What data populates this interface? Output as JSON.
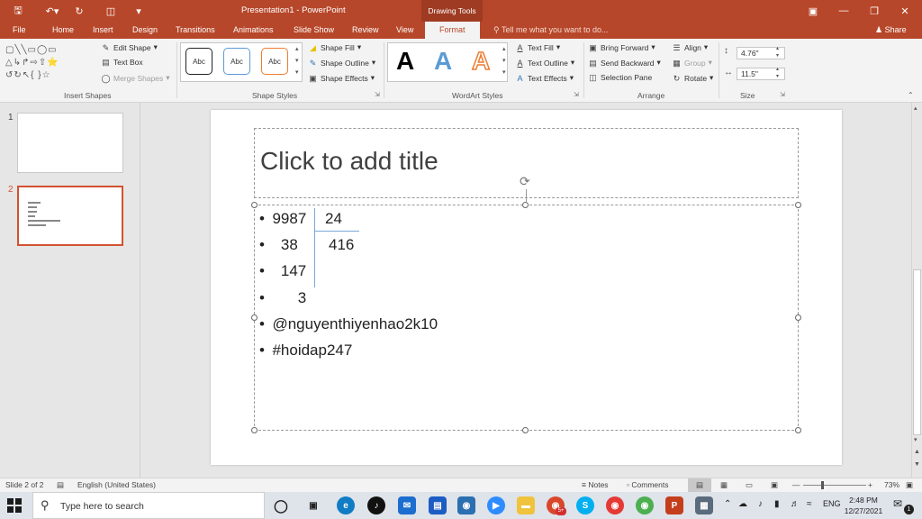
{
  "titlebar": {
    "doc_title": "Presentation1 - PowerPoint",
    "drawing_tools": "Drawing Tools"
  },
  "tabs": {
    "items": [
      "File",
      "Home",
      "Insert",
      "Design",
      "Transitions",
      "Animations",
      "Slide Show",
      "Review",
      "View",
      "Format"
    ],
    "active": "Format",
    "tell_me": "Tell me what you want to do...",
    "share": "Share"
  },
  "ribbon": {
    "insert_shapes": {
      "edit_shape": "Edit Shape",
      "text_box": "Text Box",
      "merge_shapes": "Merge Shapes",
      "label": "Insert Shapes"
    },
    "shape_styles": {
      "swatch_label": "Abc",
      "shape_fill": "Shape Fill",
      "shape_outline": "Shape Outline",
      "shape_effects": "Shape Effects",
      "label": "Shape Styles"
    },
    "wordart_styles": {
      "sample": "A",
      "text_fill": "Text Fill",
      "text_outline": "Text Outline",
      "text_effects": "Text Effects",
      "label": "WordArt Styles"
    },
    "arrange": {
      "bring_forward": "Bring Forward",
      "send_backward": "Send Backward",
      "selection_pane": "Selection Pane",
      "align": "Align",
      "group": "Group",
      "rotate": "Rotate",
      "label": "Arrange"
    },
    "size": {
      "height": "4.76\"",
      "width": "11.5\"",
      "label": "Size"
    }
  },
  "thumbnails": {
    "slide1_num": "1",
    "slide2_num": "2"
  },
  "slide": {
    "title_placeholder": "Click to add title",
    "lines": [
      {
        "left": "9987",
        "right": "24"
      },
      {
        "left": "  38",
        "right": "416"
      },
      {
        "left": "  147",
        "right": ""
      },
      {
        "left": "      3",
        "right": ""
      },
      {
        "left": "@nguyenthiyenhao2k10",
        "right": ""
      },
      {
        "left": "#hoidap247",
        "right": ""
      }
    ]
  },
  "status": {
    "slide_info": "Slide 2 of 2",
    "language": "English (United States)",
    "notes": "Notes",
    "comments": "Comments",
    "zoom": "73%"
  },
  "taskbar": {
    "search_placeholder": "Type here to search",
    "language": "ENG",
    "time": "2:48 PM",
    "date": "12/27/2021",
    "notification_count": "5"
  }
}
